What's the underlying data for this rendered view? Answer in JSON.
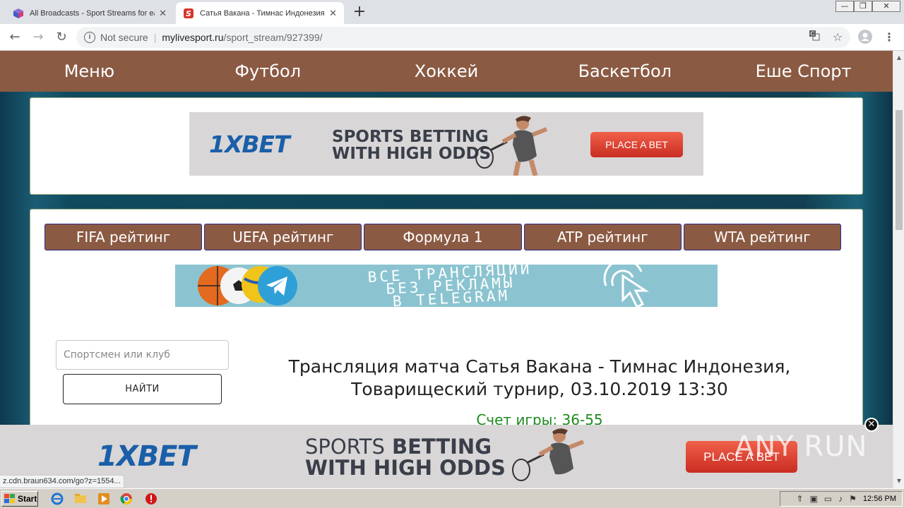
{
  "browser": {
    "tabs": [
      {
        "title": "All Broadcasts - Sport Streams for ea",
        "close": "✕"
      },
      {
        "title": "Сатья Вакана - Тимнас Индонезия",
        "close": "✕"
      }
    ],
    "new_tab": "+",
    "window_controls": {
      "minimize": "—",
      "maximize": "❐",
      "close": "✕"
    },
    "address": {
      "security": "Not secure",
      "host": "mylivesport.ru",
      "path": "/sport_stream/927399/"
    },
    "status_link": "z.cdn.braun634.com/go?z=1554..."
  },
  "site": {
    "menu": [
      "Меню",
      "Футбол",
      "Хоккей",
      "Баскетбол",
      "Еше Спорт"
    ],
    "ad_top": {
      "logo": "1XBET",
      "headline_1": "SPORTS BETTING",
      "headline_2": "WITH HIGH ODDS",
      "button": "PLACE A BET"
    },
    "rating_buttons": [
      "FIFA рейтинг",
      "UEFA рейтинг",
      "Формула 1",
      "ATP рейтинг",
      "WTA рейтинг"
    ],
    "telegram_banner": {
      "line_1": "ВСЕ ТРАНСЛЯЦИИ",
      "line_2": "БЕЗ РЕКЛАМЫ",
      "line_3": "В TELEGRAM"
    },
    "search": {
      "placeholder": "Спортсмен или клуб",
      "button": "НАЙТИ"
    },
    "match": {
      "title": "Трансляция матча Сатья Вакана - Тимнас Индонезия, Товарищеский турнир, 03.10.2019 13:30",
      "score": "Счет игры: 36-55"
    },
    "ad_bottom": {
      "logo": "1XBET",
      "headline_1a": "SPORTS",
      "headline_1b": "BETTING",
      "headline_2": "WITH HIGH ODDS",
      "button": "PLACE A BET",
      "close": "✕"
    },
    "watermark": "ANY RUN"
  },
  "taskbar": {
    "start": "Start",
    "clock": "12:56 PM"
  },
  "colors": {
    "menu_bg": "#8b5a43",
    "panel_border": "#a3ae86",
    "bet_blue": "#1a5fa8",
    "bet_button": "#e0443a",
    "score_green": "#1e8a1e",
    "telegram_bg": "#8bc4d0"
  },
  "icons": [
    "cube-icon",
    "sportstream-icon",
    "info-icon",
    "translate-icon",
    "star-icon",
    "account-icon",
    "menu-dots-icon",
    "back-icon",
    "forward-icon",
    "reload-icon",
    "telegram-icon",
    "cursor-icon",
    "ie-icon",
    "folder-icon",
    "media-icon",
    "chrome-icon",
    "stop-icon"
  ]
}
